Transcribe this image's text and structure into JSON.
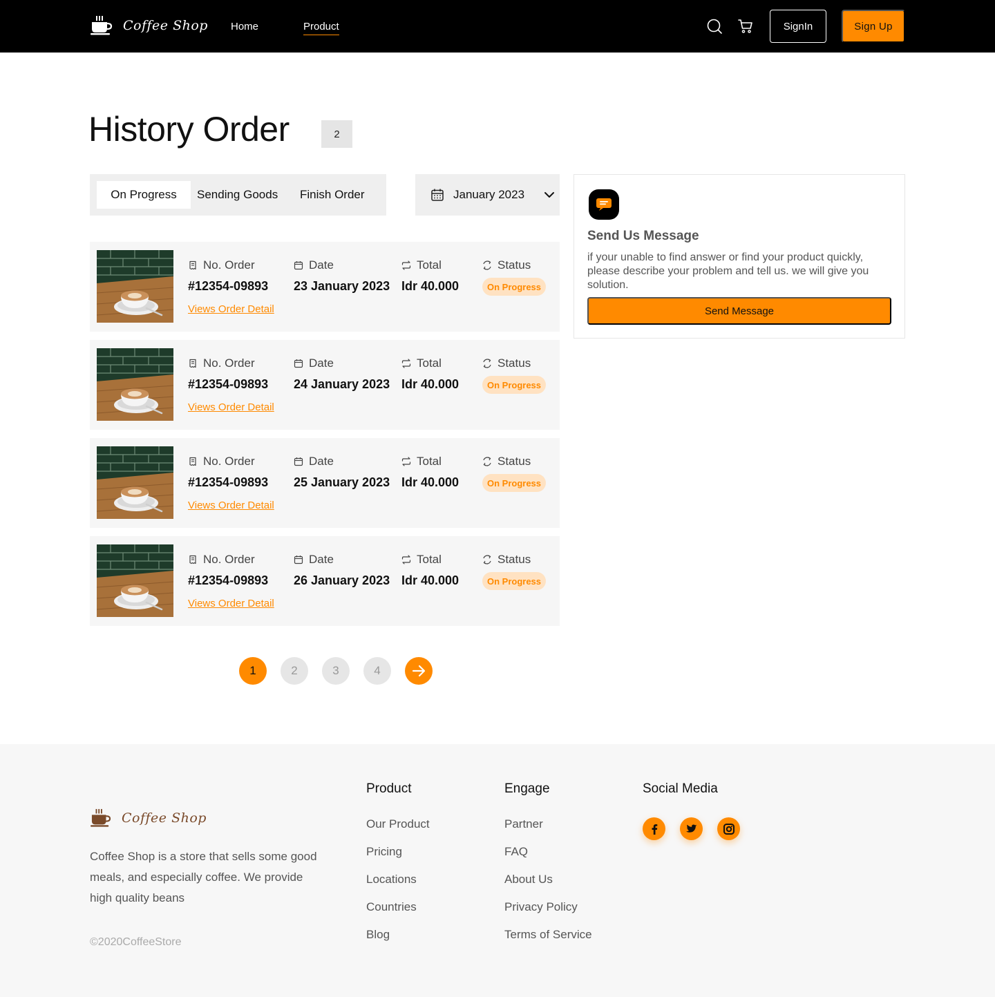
{
  "header": {
    "brand": "Coffee Shop",
    "nav": [
      {
        "label": "Home"
      },
      {
        "label": "Product"
      }
    ],
    "signin_label": "SignIn",
    "signup_label": "Sign Up"
  },
  "page": {
    "title": "History Order",
    "count_badge": "2"
  },
  "tabs": [
    {
      "label": "On Progress"
    },
    {
      "label": "Sending Goods"
    },
    {
      "label": "Finish Order"
    }
  ],
  "month_filter": "January 2023",
  "order_labels": {
    "order_no": "No. Order",
    "date": "Date",
    "total": "Total",
    "status": "Status",
    "detail_link": "Views Order Detail"
  },
  "orders": [
    {
      "order_no": "#12354-09893",
      "date": "23 January 2023",
      "total": "Idr 40.000",
      "status": "On Progress"
    },
    {
      "order_no": "#12354-09893",
      "date": "24 January 2023",
      "total": "Idr 40.000",
      "status": "On Progress"
    },
    {
      "order_no": "#12354-09893",
      "date": "25 January 2023",
      "total": "Idr 40.000",
      "status": "On Progress"
    },
    {
      "order_no": "#12354-09893",
      "date": "26 January 2023",
      "total": "Idr 40.000",
      "status": "On Progress"
    }
  ],
  "message_card": {
    "title": "Send Us Message",
    "description": "if your unable to find answer or find your product quickly, please describe your problem and tell us. we will give you solution.",
    "button_label": "Send Message"
  },
  "pagination": {
    "pages": [
      "1",
      "2",
      "3",
      "4"
    ],
    "current": "1"
  },
  "footer": {
    "brand": "Coffee Shop",
    "description": "Coffee Shop is a store that sells some good meals, and especially coffee. We provide high quality beans",
    "copyright": "©2020CoffeeStore",
    "product": {
      "title": "Product",
      "links": [
        "Our Product",
        "Pricing",
        "Locations",
        "Countries",
        "Blog"
      ]
    },
    "engage": {
      "title": "Engage",
      "links": [
        "Partner",
        "FAQ",
        "About Us",
        "Privacy Policy",
        "Terms of Service"
      ]
    },
    "social": {
      "title": "Social Media",
      "icons": [
        "facebook-icon",
        "twitter-icon",
        "instagram-icon"
      ]
    }
  },
  "colors": {
    "accent": "#ff8a00",
    "header_bg": "#000000",
    "card_bg": "#f6f6f6",
    "status_pill_bg": "#ffe2c2"
  }
}
